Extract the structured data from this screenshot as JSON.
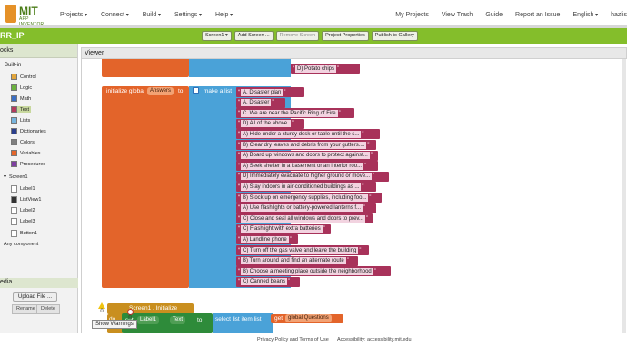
{
  "app": {
    "logo_title": "MIT",
    "logo_subtitle": "APP INVENTOR"
  },
  "topnav": [
    "Projects",
    "Connect",
    "Build",
    "Settings",
    "Help"
  ],
  "topright": {
    "my_projects": "My Projects",
    "view_trash": "View Trash",
    "guide": "Guide",
    "report": "Report an Issue",
    "language": "English",
    "user": "hazlis"
  },
  "project": {
    "name": "RR_IP"
  },
  "project_buttons": [
    "Screen1 ▾",
    "Add Screen ...",
    "Remove Screen",
    "Project Properties",
    "Publish to Gallery"
  ],
  "palette": {
    "header": "ocks",
    "builtin": "Built-in",
    "items": [
      {
        "label": "Control",
        "color": "#e1a53b"
      },
      {
        "label": "Logic",
        "color": "#6bb23e"
      },
      {
        "label": "Math",
        "color": "#3b6fc4"
      },
      {
        "label": "Text",
        "color": "#b33b5e"
      },
      {
        "label": "Lists",
        "color": "#76b4dd"
      },
      {
        "label": "Dictionaries",
        "color": "#2b3f8c"
      },
      {
        "label": "Colors",
        "color": "#7f7f7f"
      },
      {
        "label": "Variables",
        "color": "#e3642a"
      },
      {
        "label": "Procedures",
        "color": "#7e3fa1"
      }
    ],
    "screen": "Screen1",
    "components": [
      "Label1",
      "ListView1",
      "Label2",
      "Label3",
      "Button1"
    ],
    "any_component": "Any component",
    "rename": "Rename",
    "delete": "Delete",
    "media": "edia",
    "upload": "Upload File ..."
  },
  "viewer": {
    "header": "Viewer"
  },
  "blocks": {
    "prev_item": "D) Potato chips",
    "init_label": "initialize global",
    "var_name": "Answers",
    "to": "to",
    "make_list": "make a list",
    "answers": [
      "A. Disaster plan",
      "A. Disaster",
      "C. We are near the Pacific Ring of Fire",
      "D) All of the above.",
      "A) Hide under a sturdy desk or table until the s...",
      "B) Clear dry leaves and debris from your gutters....",
      "A) Board up windows and doors to protect against...",
      "A) Seek shelter in a basement or an interior roo...",
      "D) Immediately evacuate to higher ground or move...",
      "A) Stay indoors in air-conditioned buildings as ...",
      "B) Stock up on emergency supplies, including foo...",
      "A) Use flashlights or battery-powered lanterns f...",
      "C) Close and seal all windows and doors to prev...",
      "C) Flashlight with extra batteries",
      "A) Landline phone",
      "C) Turn off the gas valve and leave the building",
      "B) Turn around and find an alternate route",
      "B) Choose a meeting place outside the neighborhood",
      "C) Canned beans"
    ],
    "screen_init": "Screen1 . Initialize",
    "do": "do",
    "set": "set",
    "label1": "Label1",
    "text_prop": "Text",
    "to2": "to",
    "select_item": "select list item  list",
    "get": "get",
    "global_q": "global Questions"
  },
  "warnings": {
    "warn_count": "0",
    "error_count": "0",
    "show": "Show Warnings"
  },
  "footer": {
    "privacy": "Privacy Policy and Terms of Use",
    "accessibility": "Accessibility: accessibility.mit.edu"
  }
}
